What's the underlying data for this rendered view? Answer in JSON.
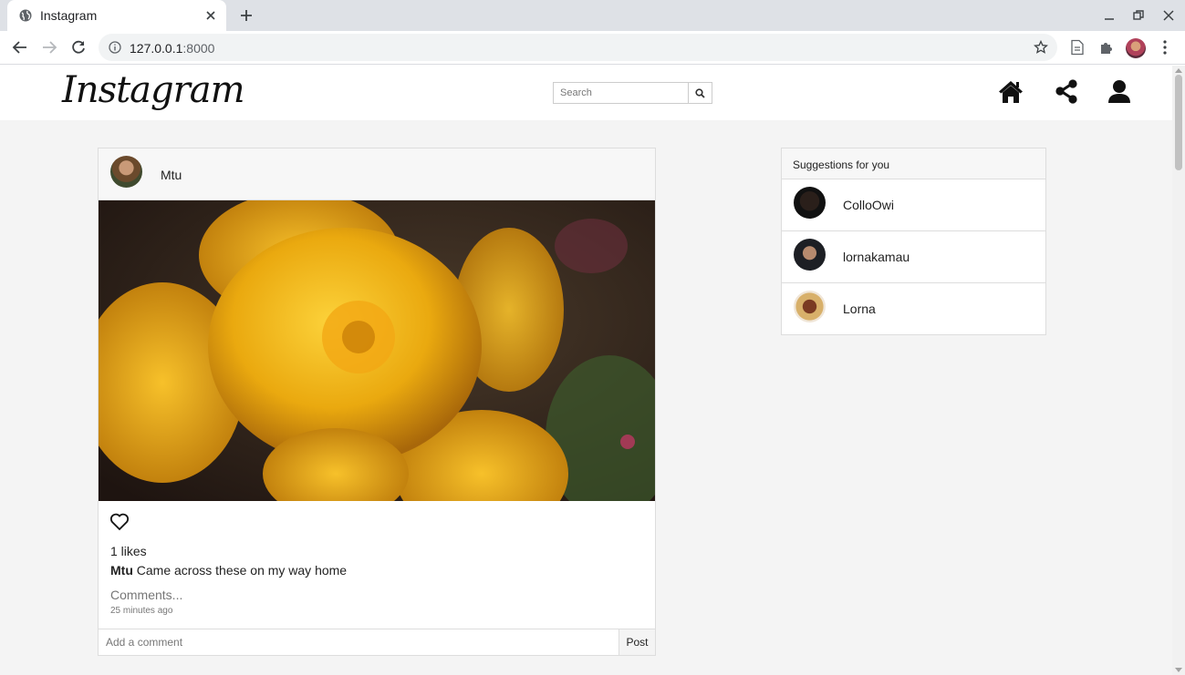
{
  "browser": {
    "tab_title": "Instagram",
    "url_host": "127.0.0.1",
    "url_port": ":8000"
  },
  "navbar": {
    "logo": "Instagram",
    "search_placeholder": "Search"
  },
  "post": {
    "username": "Mtu",
    "likes": "1 likes",
    "caption_user": "Mtu",
    "caption_text": " Came across these on my way home",
    "comments_link": "Comments...",
    "timestamp": "25 minutes ago",
    "comment_placeholder": "Add a comment",
    "post_button": "Post"
  },
  "suggestions": {
    "title": "Suggestions for you",
    "users": [
      {
        "name": "ColloOwi"
      },
      {
        "name": "lornakamau"
      },
      {
        "name": "Lorna"
      }
    ]
  }
}
